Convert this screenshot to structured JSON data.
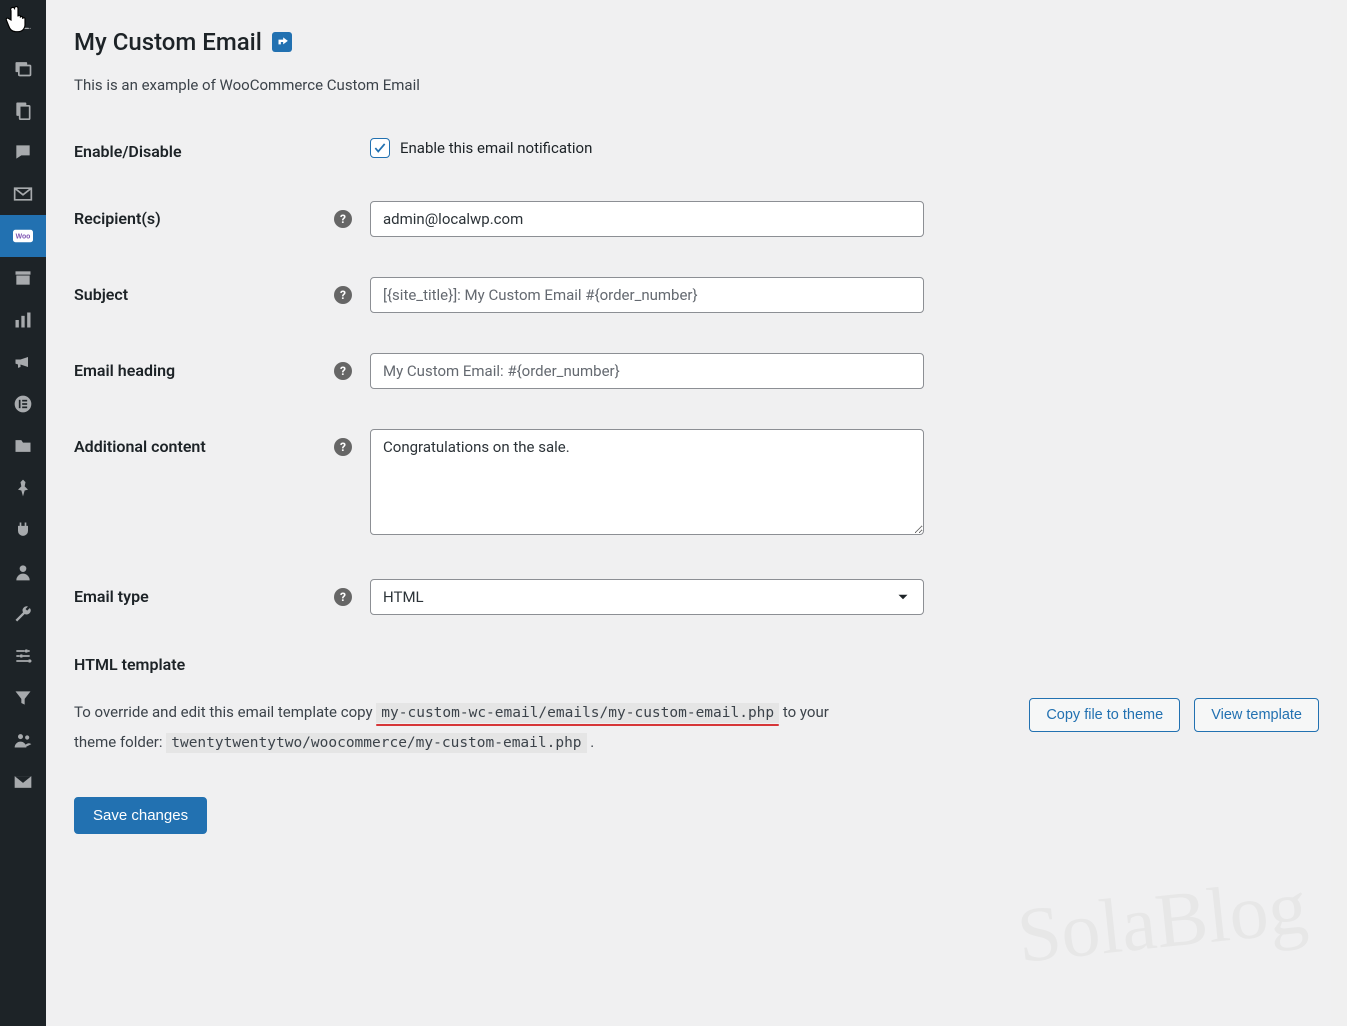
{
  "sidebar": {
    "items": [
      {
        "name": "pin-icon"
      },
      {
        "name": "media-icon"
      },
      {
        "name": "pages-icon"
      },
      {
        "name": "comments-icon"
      },
      {
        "name": "mail-icon"
      },
      {
        "name": "woo-icon",
        "active": true,
        "label": "Woo"
      },
      {
        "name": "archive-icon"
      },
      {
        "name": "analytics-icon"
      },
      {
        "name": "marketing-icon"
      },
      {
        "name": "elementor-icon"
      },
      {
        "name": "folder-icon"
      },
      {
        "name": "thumbtack-icon"
      },
      {
        "name": "plugins-icon"
      },
      {
        "name": "users-icon"
      },
      {
        "name": "tools-icon"
      },
      {
        "name": "settings-sliders-icon"
      },
      {
        "name": "filter-icon"
      },
      {
        "name": "group-icon"
      },
      {
        "name": "envelope-icon"
      }
    ]
  },
  "page": {
    "title": "My Custom Email",
    "description": "This is an example of WooCommerce Custom Email"
  },
  "fields": {
    "enable": {
      "label": "Enable/Disable",
      "checkbox_label": "Enable this email notification",
      "checked": true
    },
    "recipients": {
      "label": "Recipient(s)",
      "value": "admin@localwp.com"
    },
    "subject": {
      "label": "Subject",
      "placeholder": "[{site_title}]: My Custom Email #{order_number}",
      "value": ""
    },
    "heading": {
      "label": "Email heading",
      "placeholder": "My Custom Email: #{order_number}",
      "value": ""
    },
    "additional": {
      "label": "Additional content",
      "value": "Congratulations on the sale."
    },
    "email_type": {
      "label": "Email type",
      "selected": "HTML"
    }
  },
  "template": {
    "section_label": "HTML template",
    "text_before_code1": "To override and edit this email template copy ",
    "code1": "my-custom-wc-email/emails/my-custom-email.php",
    "text_between": " to your theme folder: ",
    "code2": "twentytwentytwo/woocommerce/my-custom-email.php",
    "text_after": " .",
    "copy_button": "Copy file to theme",
    "view_button": "View template"
  },
  "buttons": {
    "save": "Save changes"
  },
  "watermark": "SolaBlog"
}
